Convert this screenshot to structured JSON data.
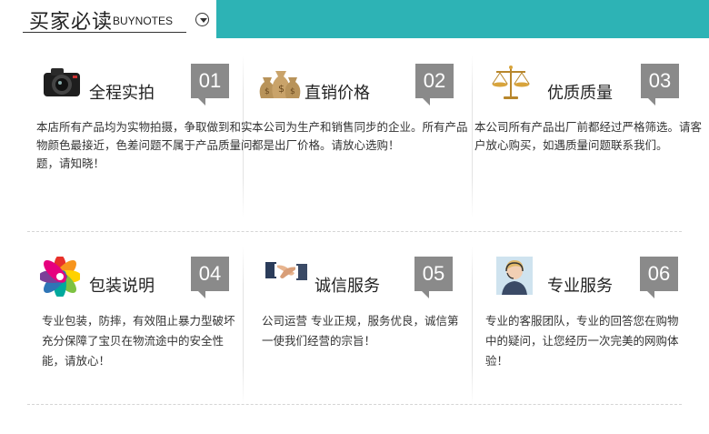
{
  "header": {
    "title_cn": "买家必读",
    "title_en": "BUYNOTES",
    "arrow_icon": "chevron-down-circle-icon",
    "bar_color": "#2db3b5"
  },
  "cards": [
    {
      "icon": "camera-icon",
      "title": "全程实拍",
      "number": "01",
      "desc": "本店所有产品均为实物拍摄，争取做到和实物颜色最接近，色差问题不属于产品质量问题，请知晓！"
    },
    {
      "icon": "money-bag-icon",
      "title": "直销价格",
      "number": "02",
      "desc": "本公司为生产和销售同步的企业。所有产品都是出厂价格。请放心选购！"
    },
    {
      "icon": "scales-icon",
      "title": "优质质量",
      "number": "03",
      "desc": "本公司所有产品出厂前都经过严格筛选。请客户放心购买，如遇质量问题联系我们。"
    },
    {
      "icon": "color-wheel-icon",
      "title": "包装说明",
      "number": "04",
      "desc": "专业包装，防摔，有效阻止暴力型破坏充分保障了宝贝在物流途中的安全性能，请放心！"
    },
    {
      "icon": "handshake-icon",
      "title": "诚信服务",
      "number": "05",
      "desc": "公司运营 专业正规，服务优良，诚信第一使我们经营的宗旨！"
    },
    {
      "icon": "headset-agent-icon",
      "title": "专业服务",
      "number": "06",
      "desc": "专业的客服团队，专业的回答您在购物中的疑问，让您经历一次完美的网购体验！"
    }
  ]
}
